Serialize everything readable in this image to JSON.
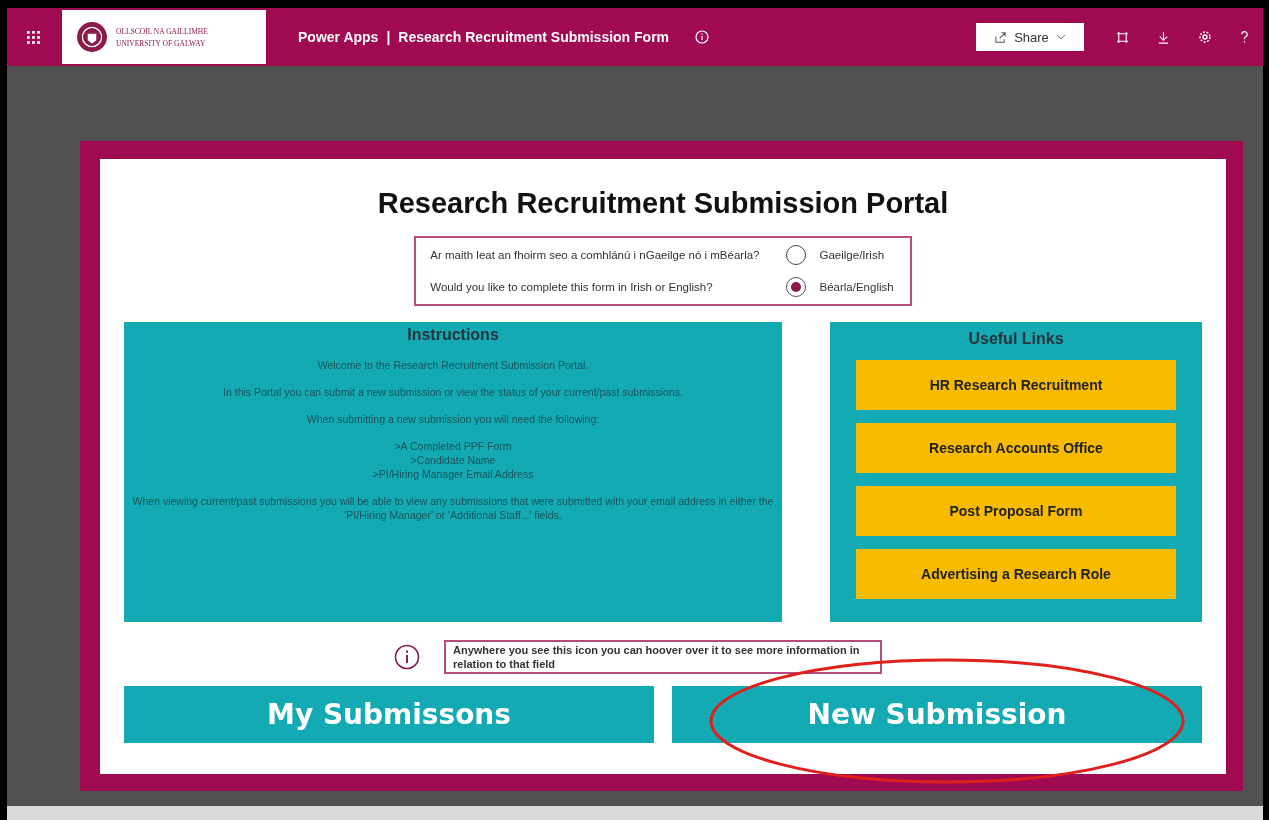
{
  "header": {
    "logo": {
      "line_1": "OLLSCOIL NA GAILLIMHE",
      "line_2": "UNIVERSITY OF GALWAY"
    },
    "app_name": "Power Apps",
    "separator": "|",
    "form_title": "Research Recruitment Submission Form",
    "share_label": "Share"
  },
  "portal": {
    "title": "Research Recruitment Submission Portal",
    "language": {
      "questions": [
        "Ar maith leat an fhoirm seo a comhlánú i nGaeilge nó i mBéarla?",
        "Would you like to complete this form in Irish or English?"
      ],
      "options": [
        {
          "label": "Gaeilge/Irish",
          "selected": false
        },
        {
          "label": "Béarla/English",
          "selected": true
        }
      ]
    },
    "instructions": {
      "heading": "Instructions",
      "paragraphs": [
        [
          "Welcome to the Research Recruitment Submission Portal."
        ],
        [
          "In this Portal you can submit a new submission or view the status of your current/past submissions."
        ],
        [
          "When submitting a new submission you will need the following:"
        ],
        [
          ">A Completed PPF Form",
          ">Candidate Name",
          ">PI/Hiring Manager Email Address"
        ],
        [
          "When viewing current/past submissions you will be able to view any submissions that were submitted with your email address in either the 'PI/Hiring Manager' or 'Additional Staff...' fields."
        ]
      ]
    },
    "useful_links": {
      "heading": "Useful Links",
      "links": [
        "HR Research Recruitment",
        "Research Accounts Office",
        "Post Proposal Form",
        "Advertising a Research Role"
      ]
    },
    "info_note": "Anywhere you see this icon you can hoover over it to see more information in relation to that field",
    "buttons": [
      "My Submissons",
      "New Submission"
    ]
  }
}
